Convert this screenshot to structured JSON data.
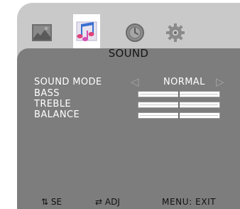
{
  "menu": {
    "tabs": [
      {
        "name": "picture",
        "icon": "picture-icon",
        "active": false
      },
      {
        "name": "sound",
        "icon": "music-notes-icon",
        "active": true
      },
      {
        "name": "time",
        "icon": "clock-icon",
        "active": false
      },
      {
        "name": "setup",
        "icon": "gear-icon",
        "active": false
      }
    ],
    "title": "SOUND",
    "items": {
      "sound_mode": {
        "label": "SOUND MODE",
        "value": "NORMAL",
        "left_arrow": "◁",
        "right_arrow": "▷"
      },
      "bass": {
        "label": "BASS",
        "level": 0.5
      },
      "treble": {
        "label": "TREBLE",
        "level": 0.5
      },
      "balance": {
        "label": "BALANCE",
        "level": 0.5
      }
    }
  },
  "footer": {
    "select": "⇅ SE",
    "adjust": "⇄ ADJ",
    "exit": "MENU: EXIT"
  },
  "colors": {
    "frame": "#c9c9c9",
    "panel": "#7d7d7d",
    "active_tab": "#ffffff",
    "accent_pink": "#e0407a"
  }
}
